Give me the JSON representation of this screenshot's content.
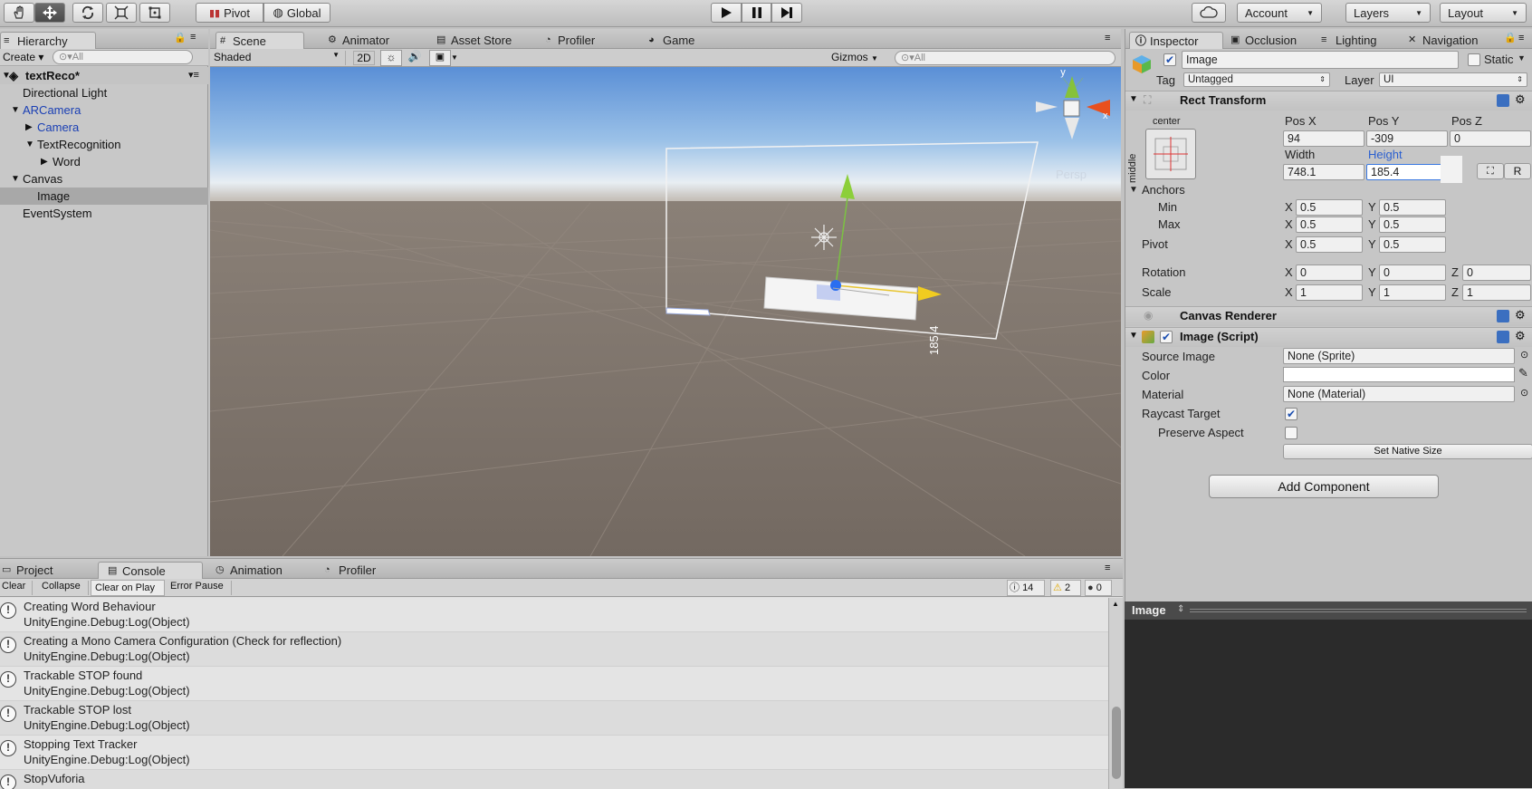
{
  "toolbar": {
    "pivot": "Pivot",
    "global": "Global",
    "account": "Account",
    "layers": "Layers",
    "layout": "Layout"
  },
  "hierarchy": {
    "tab": "Hierarchy",
    "create": "Create",
    "search_placeholder": "All",
    "scene": "textReco*",
    "items": [
      "Directional Light",
      "ARCamera",
      "Camera",
      "TextRecognition",
      "Word",
      "Canvas",
      "Image",
      "EventSystem"
    ]
  },
  "scene_tabs": [
    "Scene",
    "Animator",
    "Asset Store",
    "Profiler",
    "Game"
  ],
  "scene_bar": {
    "shading": "Shaded",
    "mode2d": "2D",
    "gizmos": "Gizmos",
    "search_placeholder": "All",
    "persp": "Persp",
    "dimension_label": "185.4",
    "axis_x": "x",
    "axis_y": "y"
  },
  "inspector": {
    "tabs": [
      "Inspector",
      "Occlusion",
      "Lighting",
      "Navigation"
    ],
    "object_name": "Image",
    "static": "Static",
    "tag_label": "Tag",
    "tag_value": "Untagged",
    "layer_label": "Layer",
    "layer_value": "UI",
    "rect_transform": {
      "title": "Rect Transform",
      "anchor_h": "center",
      "anchor_v": "middle",
      "pos_x_label": "Pos X",
      "pos_y_label": "Pos Y",
      "pos_z_label": "Pos Z",
      "pos_x": "94",
      "pos_y": "-309",
      "pos_z": "0",
      "width_label": "Width",
      "height_label": "Height",
      "width": "748.1",
      "height": "185.4",
      "r_button": "R",
      "anchors_label": "Anchors",
      "min_label": "Min",
      "max_label": "Max",
      "pivot_label": "Pivot",
      "rotation_label": "Rotation",
      "scale_label": "Scale",
      "x": "X",
      "y": "Y",
      "z": "Z",
      "min_x": "0.5",
      "min_y": "0.5",
      "max_x": "0.5",
      "max_y": "0.5",
      "pivot_x": "0.5",
      "pivot_y": "0.5",
      "rot_x": "0",
      "rot_y": "0",
      "rot_z": "0",
      "scale_x": "1",
      "scale_y": "1",
      "scale_z": "1"
    },
    "canvas_renderer": "Canvas Renderer",
    "image_script": {
      "title": "Image (Script)",
      "source_image_label": "Source Image",
      "source_image": "None (Sprite)",
      "color_label": "Color",
      "material_label": "Material",
      "material": "None (Material)",
      "raycast_label": "Raycast Target",
      "preserve_label": "Preserve Aspect",
      "native_size": "Set Native Size"
    },
    "add_component": "Add Component",
    "preview_title": "Image"
  },
  "bottom_tabs": [
    "Project",
    "Console",
    "Animation",
    "Profiler"
  ],
  "console": {
    "buttons": [
      "Clear",
      "Collapse",
      "Clear on Play",
      "Error Pause"
    ],
    "log_count": "14",
    "warn_count": "2",
    "error_count": "0",
    "entries": [
      {
        "msg": "Creating Word Behaviour",
        "src": "UnityEngine.Debug:Log(Object)"
      },
      {
        "msg": "Creating a Mono Camera Configuration (Check for reflection)",
        "src": "UnityEngine.Debug:Log(Object)"
      },
      {
        "msg": "Trackable STOP found",
        "src": "UnityEngine.Debug:Log(Object)"
      },
      {
        "msg": "Trackable STOP lost",
        "src": "UnityEngine.Debug:Log(Object)"
      },
      {
        "msg": "Stopping Text Tracker",
        "src": "UnityEngine.Debug:Log(Object)"
      },
      {
        "msg": "StopVuforia",
        "src": "UnityEngine.Debug:Log(Object)"
      }
    ]
  },
  "colors": {
    "selection": "#a8a8a8",
    "prefab_blue": "#1a3fb4",
    "dark_preview": "#2b2b2b"
  }
}
